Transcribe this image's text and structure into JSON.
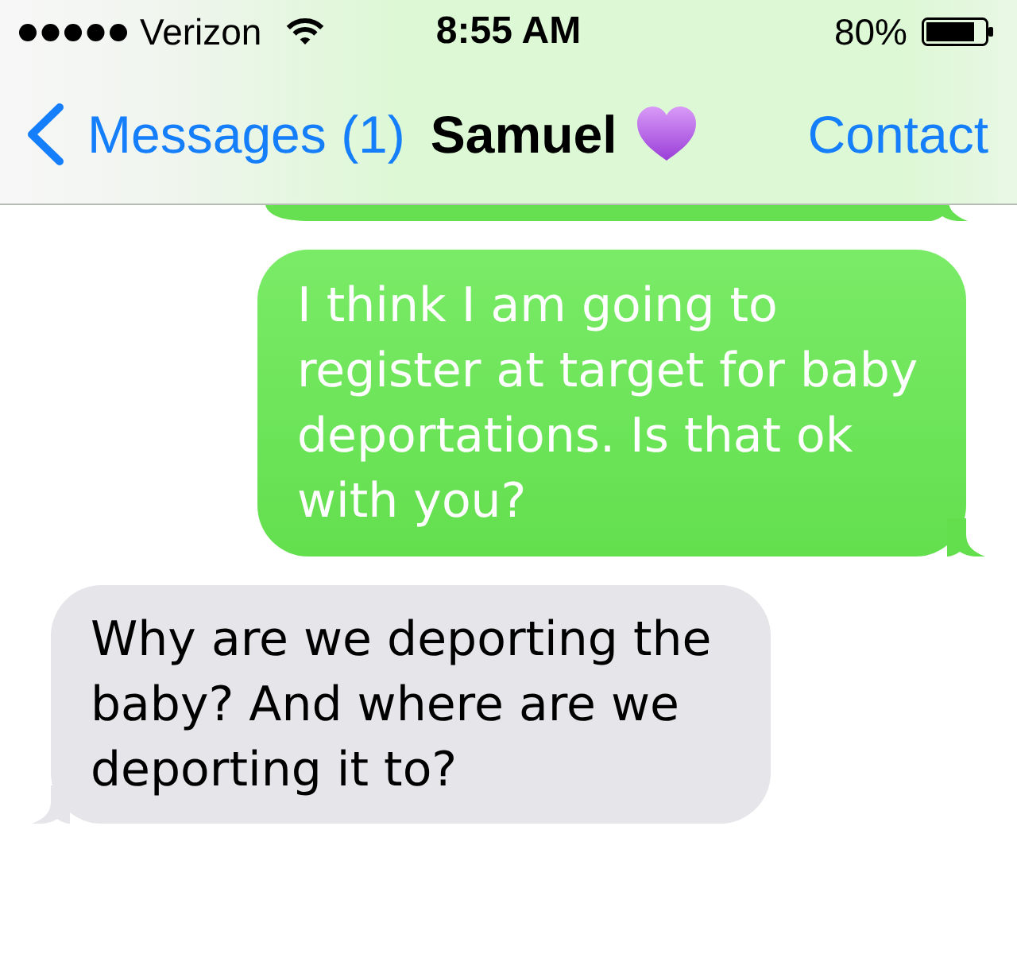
{
  "status_bar": {
    "carrier": "Verizon",
    "time": "8:55 AM",
    "battery": "80%"
  },
  "nav_bar": {
    "back": "Messages (1)",
    "title": "Samuel",
    "action": "Contact"
  },
  "messages": [
    {
      "kind": "sent",
      "text": "I think I am going to register at target for baby deportations. Is that ok with you?"
    },
    {
      "kind": "received",
      "text": "Why are we deporting the baby? And where are we deporting it to?"
    }
  ]
}
